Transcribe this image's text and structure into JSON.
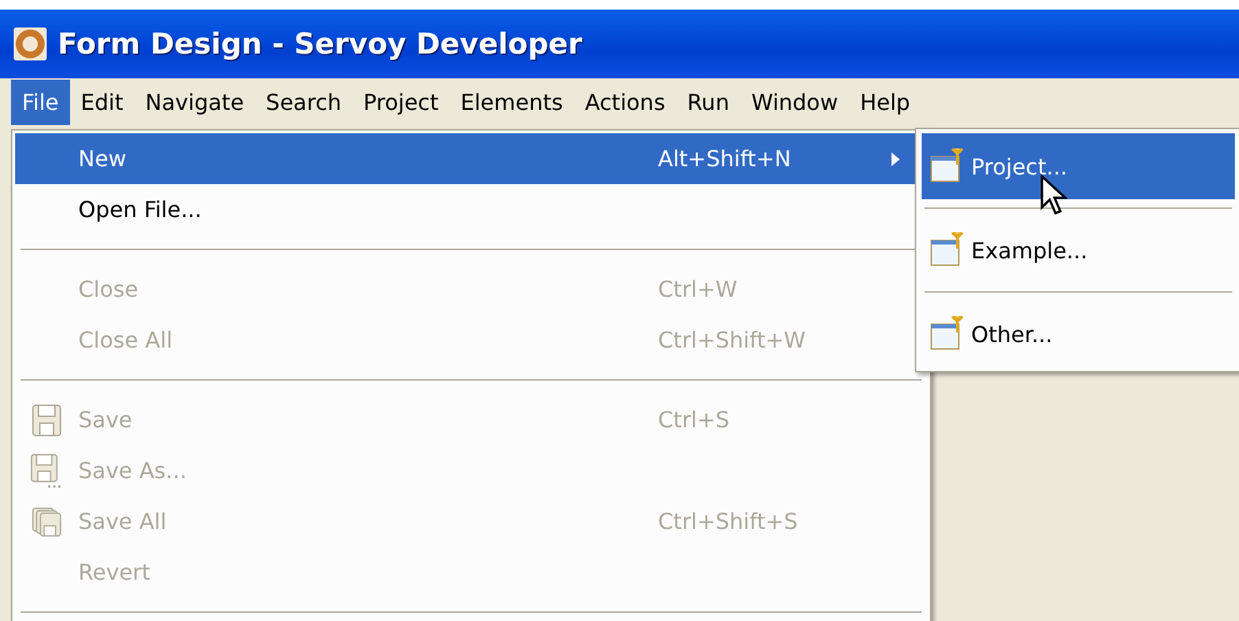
{
  "window": {
    "title": "Form Design - Servoy Developer"
  },
  "menubar": [
    {
      "label": "File",
      "selected": true
    },
    {
      "label": "Edit",
      "selected": false
    },
    {
      "label": "Navigate",
      "selected": false
    },
    {
      "label": "Search",
      "selected": false
    },
    {
      "label": "Project",
      "selected": false
    },
    {
      "label": "Elements",
      "selected": false
    },
    {
      "label": "Actions",
      "selected": false
    },
    {
      "label": "Run",
      "selected": false
    },
    {
      "label": "Window",
      "selected": false
    },
    {
      "label": "Help",
      "selected": false
    }
  ],
  "file_menu": [
    {
      "kind": "item",
      "label": "New",
      "shortcut": "Alt+Shift+N",
      "submenu": true,
      "selected": true,
      "disabled": false
    },
    {
      "kind": "item",
      "label": "Open File...",
      "selected": false,
      "disabled": false
    },
    {
      "kind": "separator"
    },
    {
      "kind": "item",
      "label": "Close",
      "shortcut": "Ctrl+W",
      "selected": false,
      "disabled": true
    },
    {
      "kind": "item",
      "label": "Close All",
      "shortcut": "Ctrl+Shift+W",
      "selected": false,
      "disabled": true
    },
    {
      "kind": "separator"
    },
    {
      "kind": "save",
      "label": "Save",
      "shortcut": "Ctrl+S",
      "selected": false,
      "disabled": true
    },
    {
      "kind": "saveas",
      "label": "Save As...",
      "selected": false,
      "disabled": true
    },
    {
      "kind": "saveall",
      "label": "Save All",
      "shortcut": "Ctrl+Shift+S",
      "selected": false,
      "disabled": true
    },
    {
      "kind": "item",
      "label": "Revert",
      "selected": false,
      "disabled": true
    },
    {
      "kind": "separator"
    }
  ],
  "new_submenu": [
    {
      "kind": "item",
      "label": "Project...",
      "selected": true
    },
    {
      "kind": "separator"
    },
    {
      "kind": "item",
      "label": "Example...",
      "selected": false
    },
    {
      "kind": "separator"
    },
    {
      "kind": "item",
      "label": "Other...",
      "selected": false
    }
  ]
}
